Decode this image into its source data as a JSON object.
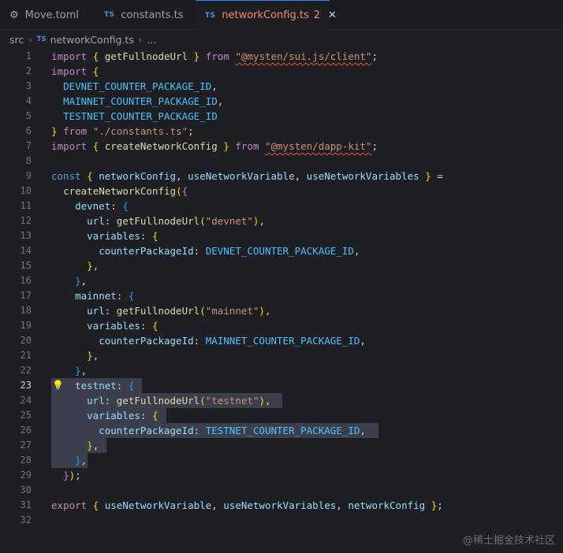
{
  "tabs": [
    {
      "icon": "gear-icon",
      "badge": "",
      "label": "Move.toml",
      "active": false
    },
    {
      "icon": "typescript-icon",
      "badge": "TS",
      "label": "constants.ts",
      "active": false
    },
    {
      "icon": "typescript-icon",
      "badge": "TS",
      "label": "networkConfig.ts",
      "error_count": "2",
      "active": true,
      "close": "✕"
    }
  ],
  "breadcrumb": {
    "folder": "src",
    "badge": "TS",
    "file": "networkConfig.ts",
    "more": "..."
  },
  "editor": {
    "current_line": 23,
    "lines": [
      {
        "n": "1",
        "t": "import { getFullnodeUrl } from \"@mysten/sui.js/client\";"
      },
      {
        "n": "2",
        "t": "import {"
      },
      {
        "n": "3",
        "t": "  DEVNET_COUNTER_PACKAGE_ID,"
      },
      {
        "n": "4",
        "t": "  MAINNET_COUNTER_PACKAGE_ID,"
      },
      {
        "n": "5",
        "t": "  TESTNET_COUNTER_PACKAGE_ID"
      },
      {
        "n": "6",
        "t": "} from \"./constants.ts\";"
      },
      {
        "n": "7",
        "t": "import { createNetworkConfig } from \"@mysten/dapp-kit\";"
      },
      {
        "n": "8",
        "t": ""
      },
      {
        "n": "9",
        "t": "const { networkConfig, useNetworkVariable, useNetworkVariables } ="
      },
      {
        "n": "10",
        "t": "  createNetworkConfig({"
      },
      {
        "n": "11",
        "t": "    devnet: {"
      },
      {
        "n": "12",
        "t": "      url: getFullnodeUrl(\"devnet\"),"
      },
      {
        "n": "13",
        "t": "      variables: {"
      },
      {
        "n": "14",
        "t": "        counterPackageId: DEVNET_COUNTER_PACKAGE_ID,"
      },
      {
        "n": "15",
        "t": "      },"
      },
      {
        "n": "16",
        "t": "    },"
      },
      {
        "n": "17",
        "t": "    mainnet: {"
      },
      {
        "n": "18",
        "t": "      url: getFullnodeUrl(\"mainnet\"),"
      },
      {
        "n": "19",
        "t": "      variables: {"
      },
      {
        "n": "20",
        "t": "        counterPackageId: MAINNET_COUNTER_PACKAGE_ID,"
      },
      {
        "n": "21",
        "t": "      },"
      },
      {
        "n": "22",
        "t": "    },"
      },
      {
        "n": "23",
        "t": "    testnet: {"
      },
      {
        "n": "24",
        "t": "      url: getFullnodeUrl(\"testnet\"),"
      },
      {
        "n": "25",
        "t": "      variables: {"
      },
      {
        "n": "26",
        "t": "        counterPackageId: TESTNET_COUNTER_PACKAGE_ID,"
      },
      {
        "n": "27",
        "t": "      },"
      },
      {
        "n": "28",
        "t": "    },"
      },
      {
        "n": "29",
        "t": "  });"
      },
      {
        "n": "30",
        "t": ""
      },
      {
        "n": "31",
        "t": "export { useNetworkVariable, useNetworkVariables, networkConfig };"
      },
      {
        "n": "32",
        "t": ""
      }
    ]
  },
  "watermark": "@稀土掘金技术社区",
  "colors": {
    "keyword": "#c586c0",
    "string": "#ce9178",
    "function": "#dcdcaa",
    "variable": "#9cdcfe",
    "constant": "#4fc1ff",
    "error": "#f48771",
    "selection": "#3a3f4b"
  }
}
